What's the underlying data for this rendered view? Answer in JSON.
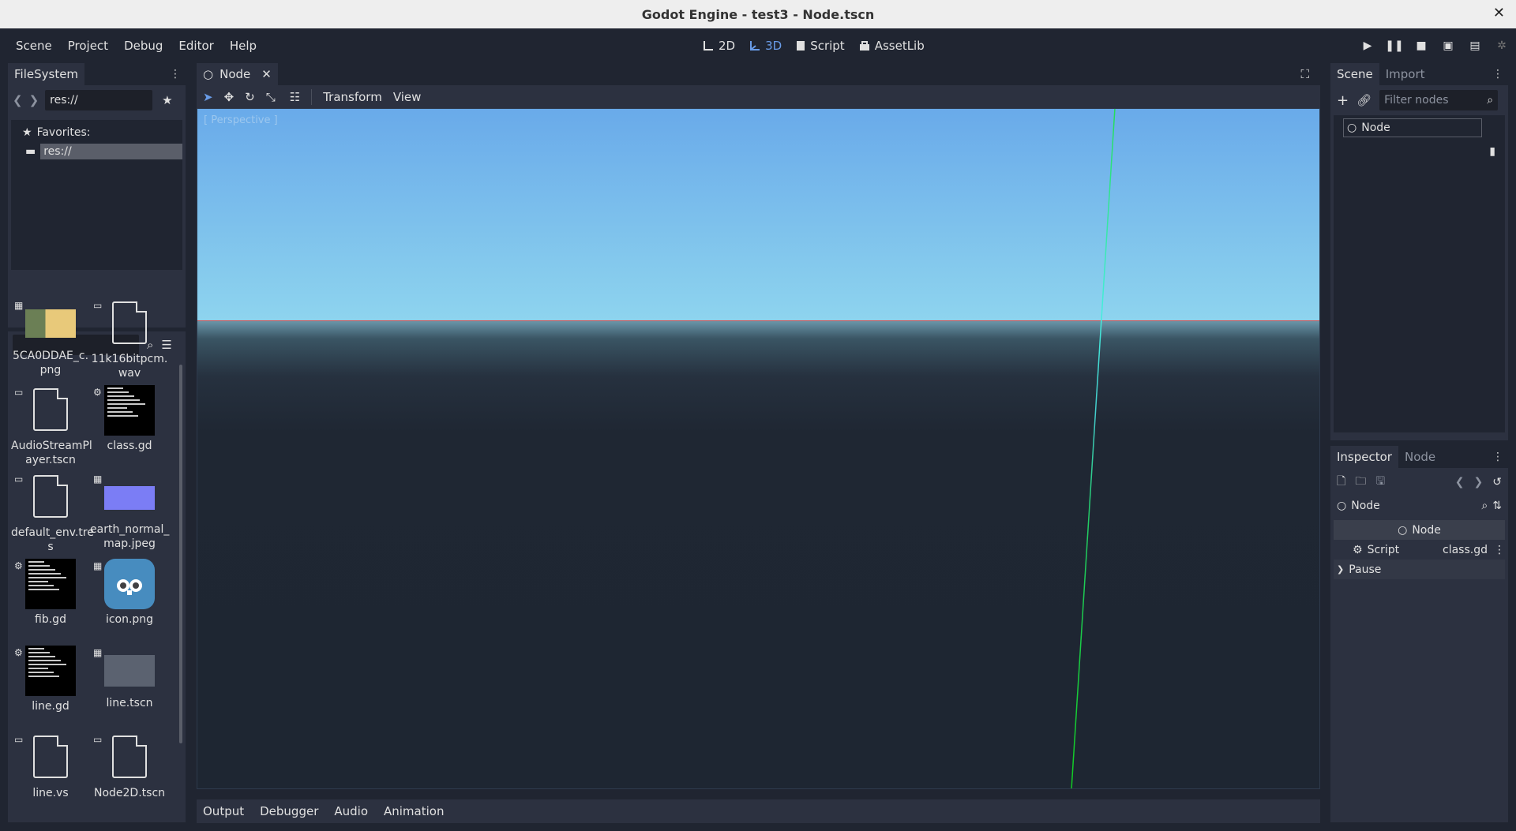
{
  "window": {
    "title": "Godot Engine - test3 - Node.tscn",
    "close_glyph": "✕"
  },
  "menu": [
    "Scene",
    "Project",
    "Debug",
    "Editor",
    "Help"
  ],
  "workspaces": [
    {
      "label": "2D",
      "icon": "2d-icon"
    },
    {
      "label": "3D",
      "icon": "3d-icon"
    },
    {
      "label": "Script",
      "icon": "script-icon"
    },
    {
      "label": "AssetLib",
      "icon": "assetlib-icon"
    }
  ],
  "filesystem": {
    "tab": "FileSystem",
    "path": "res://",
    "favorites_label": "Favorites:",
    "tree_selected": "res://",
    "files": [
      {
        "name": "5CA0DDAE_c.\npng",
        "kind": "image"
      },
      {
        "name": "11k16bitpcm.\nwav",
        "kind": "doc"
      },
      {
        "name": "AudioStreamPl\nayer.tscn",
        "kind": "doc"
      },
      {
        "name": "class.gd",
        "kind": "code"
      },
      {
        "name": "default_env.tre\ns",
        "kind": "doc"
      },
      {
        "name": "earth_normal_\nmap.jpeg",
        "kind": "purple"
      },
      {
        "name": "fib.gd",
        "kind": "code"
      },
      {
        "name": "icon.png",
        "kind": "godot"
      },
      {
        "name": "line.gd",
        "kind": "code"
      },
      {
        "name": "line.tscn",
        "kind": "mesh"
      },
      {
        "name": "line.vs",
        "kind": "doc"
      },
      {
        "name": "Node2D.tscn",
        "kind": "doc"
      }
    ]
  },
  "editor": {
    "scene_tab": "Node",
    "toolbar": {
      "transform": "Transform",
      "view": "View"
    },
    "viewport_label": "[ Perspective ]"
  },
  "scene_dock": {
    "tabs": [
      "Scene",
      "Import"
    ],
    "filter_placeholder": "Filter nodes",
    "root_node": "Node"
  },
  "inspector": {
    "tabs": [
      "Inspector",
      "Node"
    ],
    "object": "Node",
    "section": "Node",
    "script_label": "Script",
    "script_value": "class.gd",
    "pause_label": "Pause"
  },
  "bottom_tabs": [
    "Output",
    "Debugger",
    "Audio",
    "Animation"
  ],
  "colors": {
    "accent": "#699ce8",
    "bg": "#202531",
    "panel": "#2c3140"
  }
}
